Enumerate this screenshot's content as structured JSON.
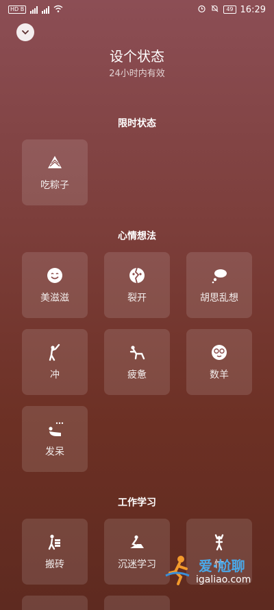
{
  "status_bar": {
    "left_badge": "HD B",
    "battery": "49",
    "time": "16:29"
  },
  "header": {
    "title": "设个状态",
    "subtitle": "24小时内有效"
  },
  "sections": [
    {
      "title": "限时状态",
      "items": [
        {
          "label": "吃粽子",
          "icon": "zongzi-icon"
        }
      ]
    },
    {
      "title": "心情想法",
      "items": [
        {
          "label": "美滋滋",
          "icon": "smile-face-icon"
        },
        {
          "label": "裂开",
          "icon": "cracked-face-icon"
        },
        {
          "label": "胡思乱想",
          "icon": "thought-bubble-icon"
        },
        {
          "label": "冲",
          "icon": "charging-person-icon"
        },
        {
          "label": "疲惫",
          "icon": "tired-person-icon"
        },
        {
          "label": "数羊",
          "icon": "sheep-face-icon"
        },
        {
          "label": "发呆",
          "icon": "daydream-person-icon"
        }
      ]
    },
    {
      "title": "工作学习",
      "items": [
        {
          "label": "搬砖",
          "icon": "carry-bricks-icon"
        },
        {
          "label": "沉迷学习",
          "icon": "studying-person-icon"
        },
        {
          "label": "忙",
          "icon": "busy-person-icon"
        }
      ]
    }
  ],
  "watermark": {
    "text": "爱·尬聊",
    "url": "igaliao.com"
  }
}
